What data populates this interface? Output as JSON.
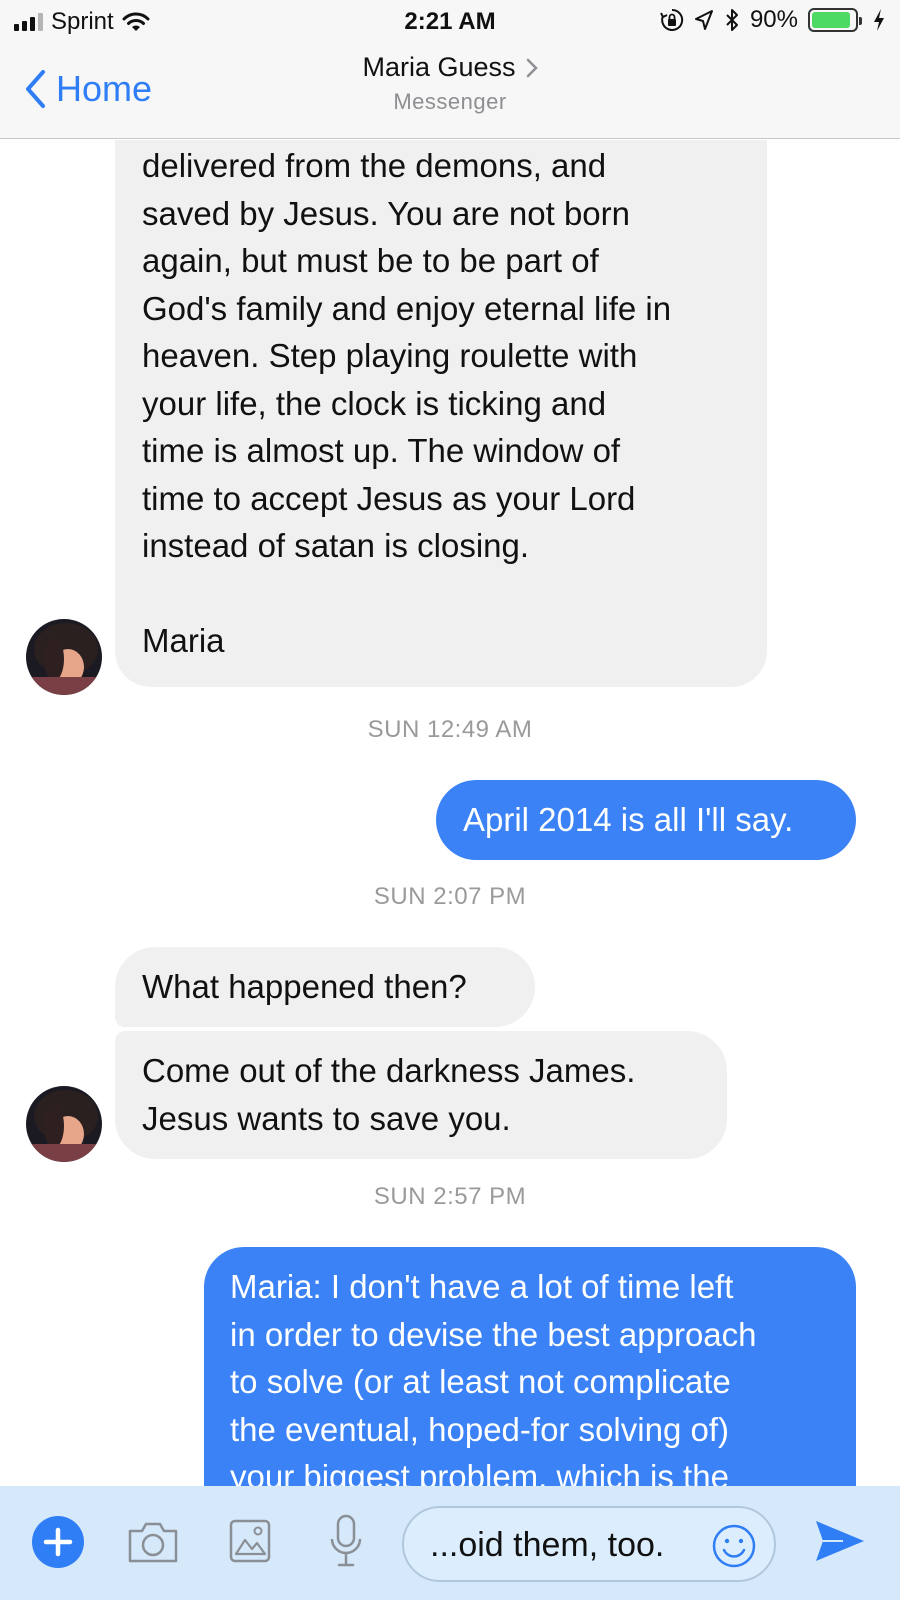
{
  "status_bar": {
    "carrier": "Sprint",
    "time": "2:21 AM",
    "battery": "90%"
  },
  "nav": {
    "back_label": "Home",
    "contact_name": "Maria Guess",
    "subtitle": "Messenger"
  },
  "messages": [
    {
      "direction": "incoming",
      "text": "delivered from the demons, and\nsaved by Jesus. You are not born\nagain, but must be to be part of\nGod's family and enjoy eternal life in\nheaven. Step playing roulette with\nyour life, the clock is ticking and\ntime  is almost up. The window of\ntime to accept Jesus as your Lord\ninstead of satan is closing.\n\nMaria"
    },
    {
      "timestamp": "SUN 12:49 AM"
    },
    {
      "direction": "outgoing",
      "text": "April 2014 is all I'll say."
    },
    {
      "timestamp": "SUN 2:07 PM"
    },
    {
      "direction": "incoming",
      "text": "What happened then?"
    },
    {
      "direction": "incoming",
      "text": "Come out of the darkness James.\nJesus wants to save you."
    },
    {
      "timestamp": "SUN 2:57 PM"
    },
    {
      "direction": "outgoing",
      "text": "Maria: I don't have a lot of time left\nin order to devise the best approach\nto solve (or at least not complicate\nthe eventual, hoped-for solving of)\nyour biggest problem, which is the"
    }
  ],
  "composer": {
    "input_value": "...oid them, too."
  },
  "colors": {
    "accent": "#3a82f6",
    "incoming_bubble": "#f0f0f0",
    "composer_bg": "#d6e9fb",
    "battery_fill": "#4cd964"
  },
  "icons": [
    "signal-icon",
    "wifi-icon",
    "lock-rotation-icon",
    "location-icon",
    "bluetooth-icon",
    "battery-icon",
    "charging-icon",
    "back-chevron-icon",
    "chevron-right-icon",
    "plus-icon",
    "camera-icon",
    "image-icon",
    "microphone-icon",
    "emoji-icon",
    "send-icon"
  ]
}
